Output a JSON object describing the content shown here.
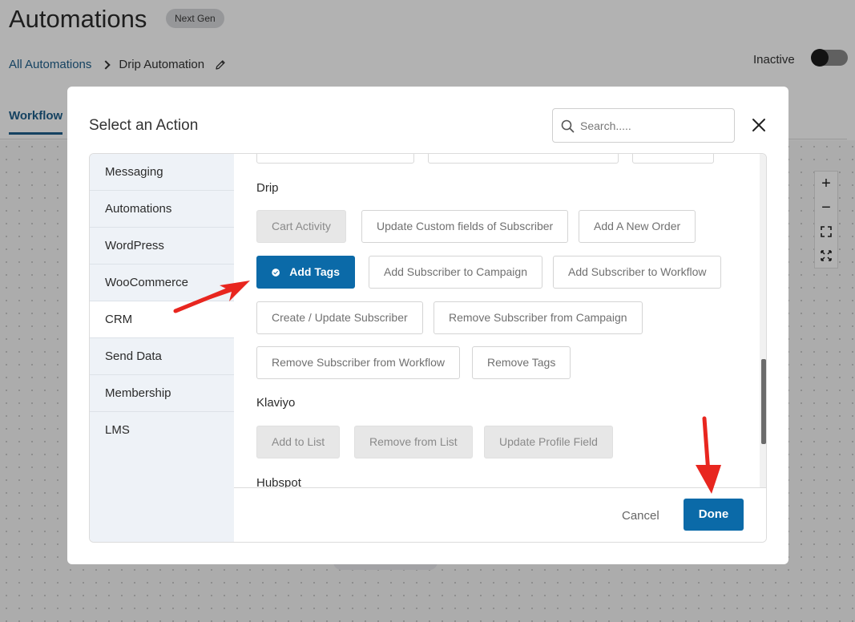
{
  "header": {
    "title": "Automations",
    "badge": "Next Gen",
    "breadcrumb": {
      "root": "All Automations",
      "current": "Drip Automation"
    },
    "status_label": "Inactive",
    "tab": "Workflow"
  },
  "canvas": {
    "zoom_in": "+",
    "zoom_out": "−"
  },
  "modal": {
    "title": "Select an Action",
    "search_placeholder": "Search.....",
    "sidebar": [
      "Messaging",
      "Automations",
      "WordPress",
      "WooCommerce",
      "CRM",
      "Send Data",
      "Membership",
      "LMS"
    ],
    "active_category": "CRM",
    "sections": {
      "drip": {
        "title": "Drip",
        "actions": [
          "Cart Activity",
          "Update Custom fields of Subscriber",
          "Add A New Order",
          "Add Tags",
          "Add Subscriber to Campaign",
          "Add Subscriber to Workflow",
          "Create / Update Subscriber",
          "Remove Subscriber from Campaign",
          "Remove Subscriber from Workflow",
          "Remove Tags"
        ]
      },
      "klaviyo": {
        "title": "Klaviyo",
        "actions": [
          "Add to List",
          "Remove from List",
          "Update Profile Field"
        ]
      },
      "hubspot": {
        "title": "Hubspot"
      }
    },
    "selected_action": "Add Tags",
    "footer": {
      "cancel": "Cancel",
      "done": "Done"
    }
  },
  "colors": {
    "primary": "#0b6aa8",
    "link": "#1f5f8b",
    "annotation": "#e8261f"
  }
}
